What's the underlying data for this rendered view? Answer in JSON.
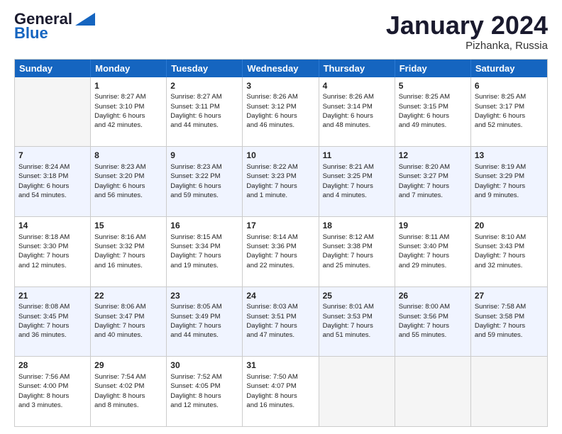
{
  "header": {
    "logo_line1": "General",
    "logo_line2": "Blue",
    "month_title": "January 2024",
    "location": "Pizhanka, Russia"
  },
  "weekdays": [
    "Sunday",
    "Monday",
    "Tuesday",
    "Wednesday",
    "Thursday",
    "Friday",
    "Saturday"
  ],
  "rows": [
    [
      {
        "day": "",
        "lines": []
      },
      {
        "day": "1",
        "lines": [
          "Sunrise: 8:27 AM",
          "Sunset: 3:10 PM",
          "Daylight: 6 hours",
          "and 42 minutes."
        ]
      },
      {
        "day": "2",
        "lines": [
          "Sunrise: 8:27 AM",
          "Sunset: 3:11 PM",
          "Daylight: 6 hours",
          "and 44 minutes."
        ]
      },
      {
        "day": "3",
        "lines": [
          "Sunrise: 8:26 AM",
          "Sunset: 3:12 PM",
          "Daylight: 6 hours",
          "and 46 minutes."
        ]
      },
      {
        "day": "4",
        "lines": [
          "Sunrise: 8:26 AM",
          "Sunset: 3:14 PM",
          "Daylight: 6 hours",
          "and 48 minutes."
        ]
      },
      {
        "day": "5",
        "lines": [
          "Sunrise: 8:25 AM",
          "Sunset: 3:15 PM",
          "Daylight: 6 hours",
          "and 49 minutes."
        ]
      },
      {
        "day": "6",
        "lines": [
          "Sunrise: 8:25 AM",
          "Sunset: 3:17 PM",
          "Daylight: 6 hours",
          "and 52 minutes."
        ]
      }
    ],
    [
      {
        "day": "7",
        "lines": [
          "Sunrise: 8:24 AM",
          "Sunset: 3:18 PM",
          "Daylight: 6 hours",
          "and 54 minutes."
        ]
      },
      {
        "day": "8",
        "lines": [
          "Sunrise: 8:23 AM",
          "Sunset: 3:20 PM",
          "Daylight: 6 hours",
          "and 56 minutes."
        ]
      },
      {
        "day": "9",
        "lines": [
          "Sunrise: 8:23 AM",
          "Sunset: 3:22 PM",
          "Daylight: 6 hours",
          "and 59 minutes."
        ]
      },
      {
        "day": "10",
        "lines": [
          "Sunrise: 8:22 AM",
          "Sunset: 3:23 PM",
          "Daylight: 7 hours",
          "and 1 minute."
        ]
      },
      {
        "day": "11",
        "lines": [
          "Sunrise: 8:21 AM",
          "Sunset: 3:25 PM",
          "Daylight: 7 hours",
          "and 4 minutes."
        ]
      },
      {
        "day": "12",
        "lines": [
          "Sunrise: 8:20 AM",
          "Sunset: 3:27 PM",
          "Daylight: 7 hours",
          "and 7 minutes."
        ]
      },
      {
        "day": "13",
        "lines": [
          "Sunrise: 8:19 AM",
          "Sunset: 3:29 PM",
          "Daylight: 7 hours",
          "and 9 minutes."
        ]
      }
    ],
    [
      {
        "day": "14",
        "lines": [
          "Sunrise: 8:18 AM",
          "Sunset: 3:30 PM",
          "Daylight: 7 hours",
          "and 12 minutes."
        ]
      },
      {
        "day": "15",
        "lines": [
          "Sunrise: 8:16 AM",
          "Sunset: 3:32 PM",
          "Daylight: 7 hours",
          "and 16 minutes."
        ]
      },
      {
        "day": "16",
        "lines": [
          "Sunrise: 8:15 AM",
          "Sunset: 3:34 PM",
          "Daylight: 7 hours",
          "and 19 minutes."
        ]
      },
      {
        "day": "17",
        "lines": [
          "Sunrise: 8:14 AM",
          "Sunset: 3:36 PM",
          "Daylight: 7 hours",
          "and 22 minutes."
        ]
      },
      {
        "day": "18",
        "lines": [
          "Sunrise: 8:12 AM",
          "Sunset: 3:38 PM",
          "Daylight: 7 hours",
          "and 25 minutes."
        ]
      },
      {
        "day": "19",
        "lines": [
          "Sunrise: 8:11 AM",
          "Sunset: 3:40 PM",
          "Daylight: 7 hours",
          "and 29 minutes."
        ]
      },
      {
        "day": "20",
        "lines": [
          "Sunrise: 8:10 AM",
          "Sunset: 3:43 PM",
          "Daylight: 7 hours",
          "and 32 minutes."
        ]
      }
    ],
    [
      {
        "day": "21",
        "lines": [
          "Sunrise: 8:08 AM",
          "Sunset: 3:45 PM",
          "Daylight: 7 hours",
          "and 36 minutes."
        ]
      },
      {
        "day": "22",
        "lines": [
          "Sunrise: 8:06 AM",
          "Sunset: 3:47 PM",
          "Daylight: 7 hours",
          "and 40 minutes."
        ]
      },
      {
        "day": "23",
        "lines": [
          "Sunrise: 8:05 AM",
          "Sunset: 3:49 PM",
          "Daylight: 7 hours",
          "and 44 minutes."
        ]
      },
      {
        "day": "24",
        "lines": [
          "Sunrise: 8:03 AM",
          "Sunset: 3:51 PM",
          "Daylight: 7 hours",
          "and 47 minutes."
        ]
      },
      {
        "day": "25",
        "lines": [
          "Sunrise: 8:01 AM",
          "Sunset: 3:53 PM",
          "Daylight: 7 hours",
          "and 51 minutes."
        ]
      },
      {
        "day": "26",
        "lines": [
          "Sunrise: 8:00 AM",
          "Sunset: 3:56 PM",
          "Daylight: 7 hours",
          "and 55 minutes."
        ]
      },
      {
        "day": "27",
        "lines": [
          "Sunrise: 7:58 AM",
          "Sunset: 3:58 PM",
          "Daylight: 7 hours",
          "and 59 minutes."
        ]
      }
    ],
    [
      {
        "day": "28",
        "lines": [
          "Sunrise: 7:56 AM",
          "Sunset: 4:00 PM",
          "Daylight: 8 hours",
          "and 3 minutes."
        ]
      },
      {
        "day": "29",
        "lines": [
          "Sunrise: 7:54 AM",
          "Sunset: 4:02 PM",
          "Daylight: 8 hours",
          "and 8 minutes."
        ]
      },
      {
        "day": "30",
        "lines": [
          "Sunrise: 7:52 AM",
          "Sunset: 4:05 PM",
          "Daylight: 8 hours",
          "and 12 minutes."
        ]
      },
      {
        "day": "31",
        "lines": [
          "Sunrise: 7:50 AM",
          "Sunset: 4:07 PM",
          "Daylight: 8 hours",
          "and 16 minutes."
        ]
      },
      {
        "day": "",
        "lines": []
      },
      {
        "day": "",
        "lines": []
      },
      {
        "day": "",
        "lines": []
      }
    ]
  ]
}
